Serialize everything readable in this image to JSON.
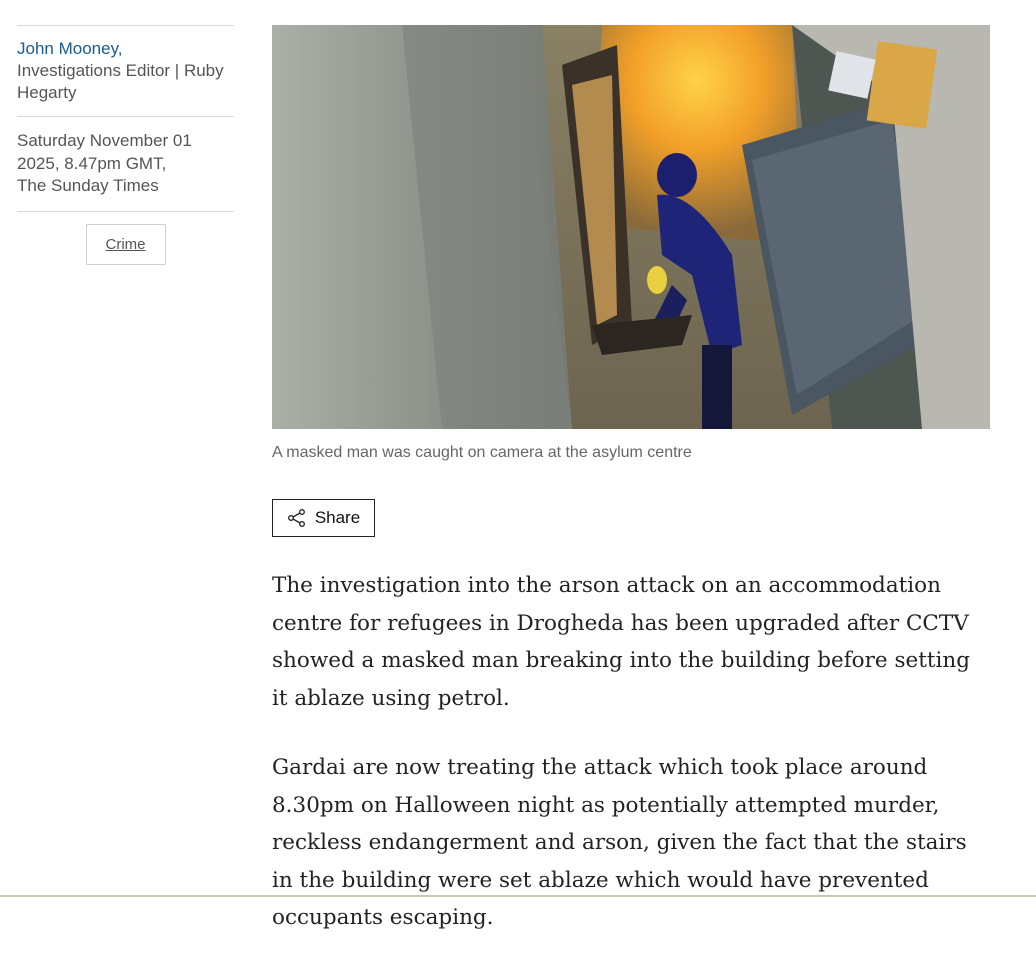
{
  "sidebar": {
    "author_name": "John Mooney,",
    "author_role": "Investigations Editor | Ruby Hegarty",
    "date_line1": "Saturday November 01",
    "date_line2": "2025, 8.47pm GMT,",
    "publication": "The Sunday Times",
    "tag": "Crime"
  },
  "media": {
    "caption": "A masked man was caught on camera at the asylum centre"
  },
  "share": {
    "label": "Share",
    "icon": "share-icon"
  },
  "article": {
    "paragraphs": [
      "The investigation into the arson attack on an accommodation centre for refugees in Drogheda has been upgraded after CCTV showed a masked man breaking into the building before setting it ablaze using petrol.",
      "Gardai are now treating the attack which took place around 8.30pm on Halloween night as potentially attempted murder, reckless endangerment and arson, given the fact that the stairs in the building were set ablaze which would have prevented occupants escaping."
    ]
  },
  "colors": {
    "author_link": "#1a5c8e",
    "body_text": "#222222",
    "muted_text": "#555555"
  }
}
